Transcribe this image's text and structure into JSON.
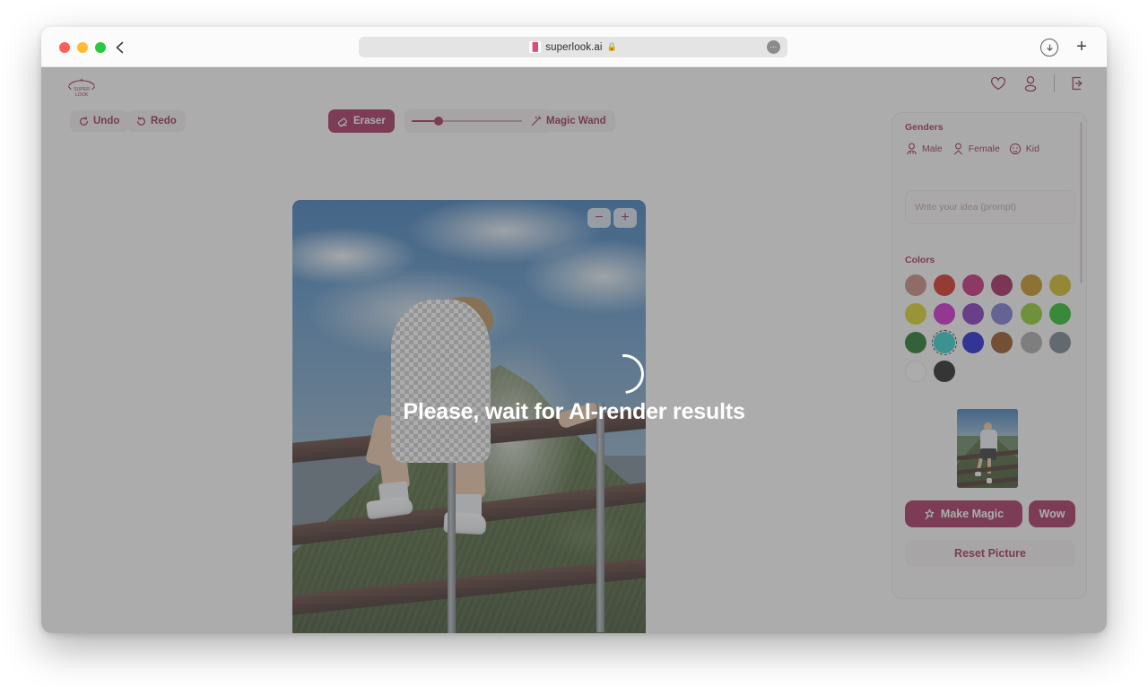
{
  "browser": {
    "url": "superlook.ai",
    "favicon_icon": "superlook-favicon-icon",
    "lock_icon": "lock-icon",
    "back_icon": "chevron-left-icon",
    "menu_icon": "more-dots-icon",
    "download_icon": "download-icon",
    "newtab_icon": "plus-icon"
  },
  "app": {
    "brand": "SUPER LOOK",
    "header_icons": [
      {
        "name": "favorites-icon",
        "glyph": "heart-icon"
      },
      {
        "name": "account-icon",
        "glyph": "person-icon"
      },
      {
        "name": "logout-icon",
        "glyph": "exit-icon"
      }
    ]
  },
  "toolbar": {
    "undo_label": "Undo",
    "undo_icon": "undo-arrow-icon",
    "redo_label": "Redo",
    "redo_icon": "redo-arrow-icon",
    "eraser_label": "Eraser",
    "eraser_icon": "eraser-icon",
    "eraser_active": true,
    "brush_size_percent": 20,
    "magic_wand_label": "Magic Wand",
    "magic_wand_icon": "magic-wand-icon"
  },
  "canvas": {
    "zoom_out_label": "−",
    "zoom_in_label": "+",
    "zoom_out_icon": "minus-icon",
    "zoom_in_icon": "plus-icon"
  },
  "loading": {
    "message": "Please, wait for AI-render results",
    "spinner_icon": "spinner-icon"
  },
  "panel": {
    "genders_label": "Genders",
    "genders": [
      {
        "label": "Male",
        "icon": "male-person-icon"
      },
      {
        "label": "Female",
        "icon": "female-person-icon"
      },
      {
        "label": "Kid",
        "icon": "kid-face-icon"
      }
    ],
    "prompt_placeholder": "Write your idea (prompt)",
    "prompt_value": "",
    "colors_label": "Colors",
    "colors": [
      {
        "name": "rosy-brown",
        "hex": "#c67f74",
        "selected": false
      },
      {
        "name": "red",
        "hex": "#d21b10",
        "selected": false
      },
      {
        "name": "magenta-pink",
        "hex": "#c3186e",
        "selected": false
      },
      {
        "name": "dark-magenta",
        "hex": "#9c1252",
        "selected": false
      },
      {
        "name": "dark-goldenrod",
        "hex": "#c28a11",
        "selected": false
      },
      {
        "name": "gold",
        "hex": "#cfb516",
        "selected": false
      },
      {
        "name": "yellow",
        "hex": "#d8cf16",
        "selected": false
      },
      {
        "name": "magenta",
        "hex": "#c818c8",
        "selected": false
      },
      {
        "name": "purple",
        "hex": "#7b25bb",
        "selected": false
      },
      {
        "name": "slate-blue",
        "hex": "#6f6fcf",
        "selected": false
      },
      {
        "name": "yellow-green",
        "hex": "#84c818",
        "selected": false
      },
      {
        "name": "green",
        "hex": "#18b81c",
        "selected": false
      },
      {
        "name": "dark-green",
        "hex": "#0d6b18",
        "selected": false
      },
      {
        "name": "turquoise",
        "hex": "#1ec8c8",
        "selected": true
      },
      {
        "name": "blue",
        "hex": "#0a10cf",
        "selected": false
      },
      {
        "name": "brown",
        "hex": "#8a4411",
        "selected": false
      },
      {
        "name": "gray",
        "hex": "#a3a3a3",
        "selected": false
      },
      {
        "name": "slate-gray",
        "hex": "#6c7a85",
        "selected": false
      },
      {
        "name": "white",
        "hex": "#ffffff",
        "selected": false
      },
      {
        "name": "black",
        "hex": "#111111",
        "selected": false
      }
    ],
    "thumbnail_name": "source-photo-thumbnail",
    "make_magic_label": "Make Magic",
    "make_magic_icon": "magic-wand-icon",
    "wow_label": "Wow",
    "reset_label": "Reset Picture"
  },
  "theme": {
    "accent": "#9e1f50",
    "accent_text": "#8e1e4b",
    "panel_bg": "#fdfbfc",
    "overlay": "rgba(90,90,90,.50)"
  }
}
